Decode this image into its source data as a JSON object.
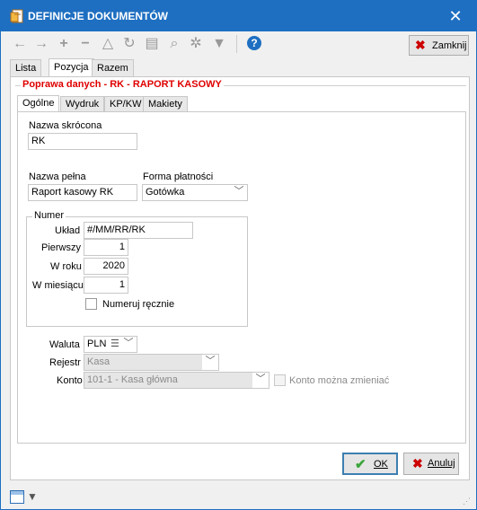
{
  "window": {
    "title": "DEFINICJE DOKUMENTÓW"
  },
  "toolbar": {
    "icons": [
      "back-icon",
      "forward-icon",
      "add-icon",
      "remove-icon",
      "edit-icon",
      "refresh-icon",
      "print-icon",
      "preview-icon",
      "settings-icon",
      "filter-icon",
      "help-icon"
    ],
    "close_label": "Zamknij"
  },
  "main_tabs": [
    "Lista",
    "Pozycja",
    "Razem"
  ],
  "section_title": "Poprawa danych - RK - RAPORT KASOWY",
  "sub_tabs": [
    "Ogólne",
    "Wydruk",
    "KP/KW",
    "Makiety"
  ],
  "form": {
    "short_name_label": "Nazwa skrócona",
    "short_name_value": "RK",
    "full_name_label": "Nazwa pełna",
    "full_name_value": "Raport kasowy RK",
    "payment_form_label": "Forma płatności",
    "payment_form_value": "Gotówka",
    "numbering": {
      "title": "Numer",
      "layout_label": "Układ",
      "layout_value": "#/MM/RR/RK",
      "first_label": "Pierwszy",
      "first_value": "1",
      "year_label": "W roku",
      "year_value": "2020",
      "month_label": "W miesiącu",
      "month_value": "1",
      "manual_label": "Numeruj ręcznie"
    },
    "currency_label": "Waluta",
    "currency_value": "PLN",
    "register_label": "Rejestr",
    "register_value": "Kasa",
    "account_label": "Konto",
    "account_value": "101-1 - Kasa główna",
    "account_change_label": "Konto można zmieniać"
  },
  "buttons": {
    "ok": "OK",
    "cancel": "Anuluj"
  },
  "colors": {
    "titlebar": "#1e6fc1",
    "section_title": "#e00000"
  }
}
